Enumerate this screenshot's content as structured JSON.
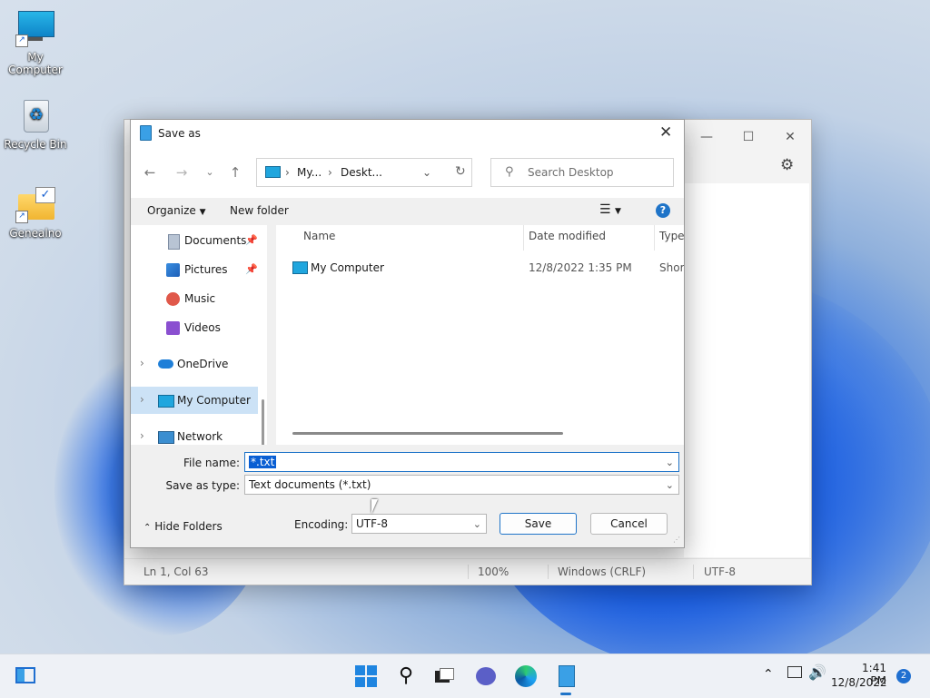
{
  "desktop": {
    "icons": [
      {
        "label": "My Computer"
      },
      {
        "label": "Recycle Bin"
      },
      {
        "label": "Genealno"
      }
    ]
  },
  "notepad": {
    "status": {
      "position": "Ln 1, Col 63",
      "zoom": "100%",
      "line_ending": "Windows (CRLF)",
      "encoding": "UTF-8"
    }
  },
  "dialog": {
    "title": "Save as",
    "address": {
      "segment1": "My...",
      "segment2": "Deskt..."
    },
    "search_placeholder": "Search Desktop",
    "toolbar": {
      "organize": "Organize",
      "new_folder": "New folder"
    },
    "nav_items": [
      {
        "label": "Documents"
      },
      {
        "label": "Pictures"
      },
      {
        "label": "Music"
      },
      {
        "label": "Videos"
      },
      {
        "label": "OneDrive"
      },
      {
        "label": "My Computer"
      },
      {
        "label": "Network"
      }
    ],
    "columns": {
      "name": "Name",
      "date": "Date modified",
      "type": "Type"
    },
    "files": [
      {
        "name": "My Computer",
        "date": "12/8/2022 1:35 PM",
        "type": "Short"
      }
    ],
    "file_name_label": "File name:",
    "file_name_value": "*.txt",
    "save_type_label": "Save as type:",
    "save_type_value": "Text documents (*.txt)",
    "hide_folders": "Hide Folders",
    "encoding_label": "Encoding:",
    "encoding_value": "UTF-8",
    "save_button": "Save",
    "cancel_button": "Cancel"
  },
  "taskbar": {
    "time": "1:41 PM",
    "date": "12/8/2022",
    "notification_count": "2"
  }
}
